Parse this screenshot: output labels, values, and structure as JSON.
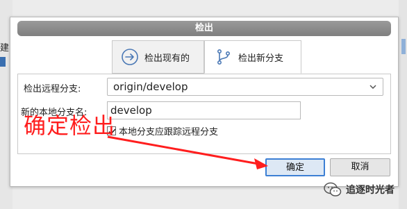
{
  "background": {
    "left_fragment_text": "建"
  },
  "dialog": {
    "title": "检出",
    "tabs": [
      {
        "label": "检出现有的",
        "icon": "arrow-right-circle-icon",
        "active": false
      },
      {
        "label": "检出新分支",
        "icon": "branch-icon",
        "active": true
      }
    ],
    "remote_branch_label": "检出远程分支:",
    "remote_branch_value": "origin/develop",
    "new_branch_label": "新的本地分支名:",
    "new_branch_value": "develop",
    "track_checkbox_label": "本地分支应跟踪远程分支",
    "track_checked": true,
    "ok_label": "确定",
    "cancel_label": "取消"
  },
  "annotation": {
    "text": "确定检出",
    "color": "#ff1e1e"
  },
  "watermark": {
    "text": "追逐时光者"
  },
  "colors": {
    "titlebar": "#8c8c8c",
    "accent": "#3c7fd4"
  }
}
